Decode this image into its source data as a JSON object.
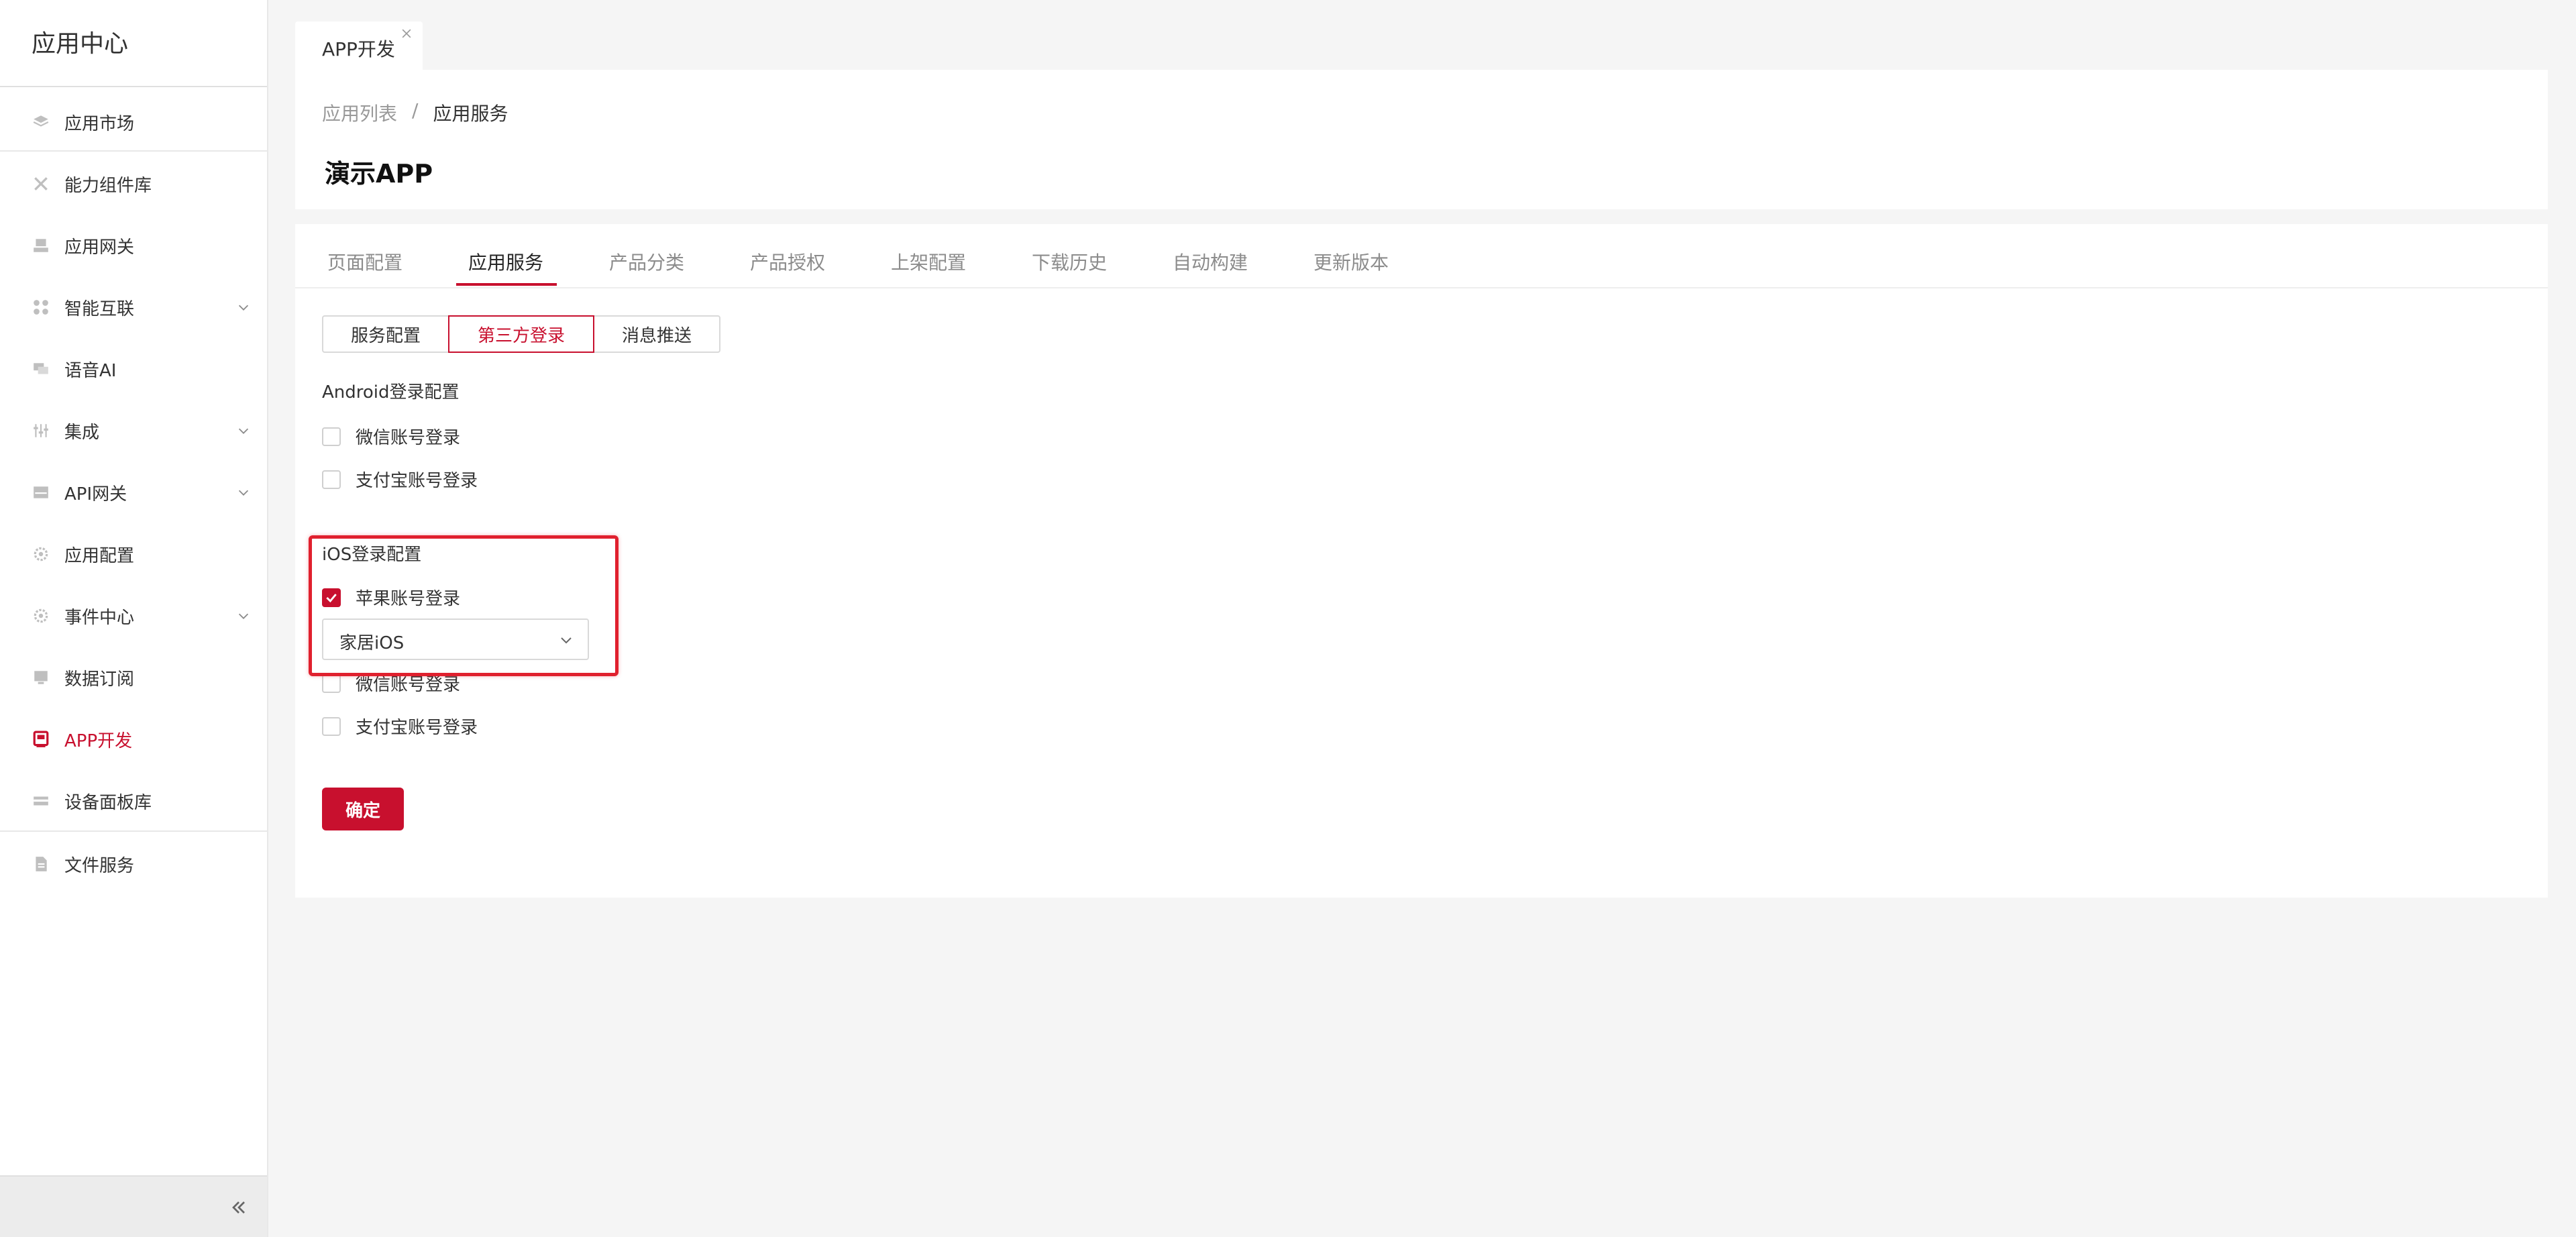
{
  "sidebar": {
    "title": "应用中心",
    "items": [
      {
        "label": "应用市场",
        "icon": "layers-icon"
      },
      {
        "label": "能力组件库",
        "icon": "tools-icon"
      },
      {
        "label": "应用网关",
        "icon": "gateway-icon"
      },
      {
        "label": "智能互联",
        "icon": "grid-icon",
        "expandable": true
      },
      {
        "label": "语音AI",
        "icon": "chat-icon"
      },
      {
        "label": "集成",
        "icon": "sliders-icon",
        "expandable": true
      },
      {
        "label": "API网关",
        "icon": "api-icon",
        "expandable": true
      },
      {
        "label": "应用配置",
        "icon": "gear-icon"
      },
      {
        "label": "事件中心",
        "icon": "gear-icon",
        "expandable": true
      },
      {
        "label": "数据订阅",
        "icon": "monitor-icon"
      },
      {
        "label": "APP开发",
        "icon": "app-icon",
        "active": true
      },
      {
        "label": "设备面板库",
        "icon": "panel-icon"
      },
      {
        "label": "文件服务",
        "icon": "file-icon"
      }
    ],
    "collapse_icon": "double-chevron-left-icon"
  },
  "page_tab": {
    "label": "APP开发",
    "close_icon": "close-icon"
  },
  "header": {
    "breadcrumb": [
      "应用列表",
      "/",
      "应用服务"
    ],
    "title": "演示APP"
  },
  "tabs": [
    "页面配置",
    "应用服务",
    "产品分类",
    "产品授权",
    "上架配置",
    "下载历史",
    "自动构建",
    "更新版本"
  ],
  "active_tab": "应用服务",
  "segments": [
    "服务配置",
    "第三方登录",
    "消息推送"
  ],
  "active_segment": "第三方登录",
  "android": {
    "title": "Android登录配置",
    "options": [
      {
        "label": "微信账号登录",
        "checked": false
      },
      {
        "label": "支付宝账号登录",
        "checked": false
      }
    ]
  },
  "ios": {
    "title": "iOS登录配置",
    "options": [
      {
        "label": "苹果账号登录",
        "checked": true
      },
      {
        "label": "微信账号登录",
        "checked": false
      },
      {
        "label": "支付宝账号登录",
        "checked": false
      }
    ],
    "select_value": "家居iOS"
  },
  "confirm_label": "确定",
  "colors": {
    "accent": "#c8102e",
    "highlight": "#e0202e"
  }
}
